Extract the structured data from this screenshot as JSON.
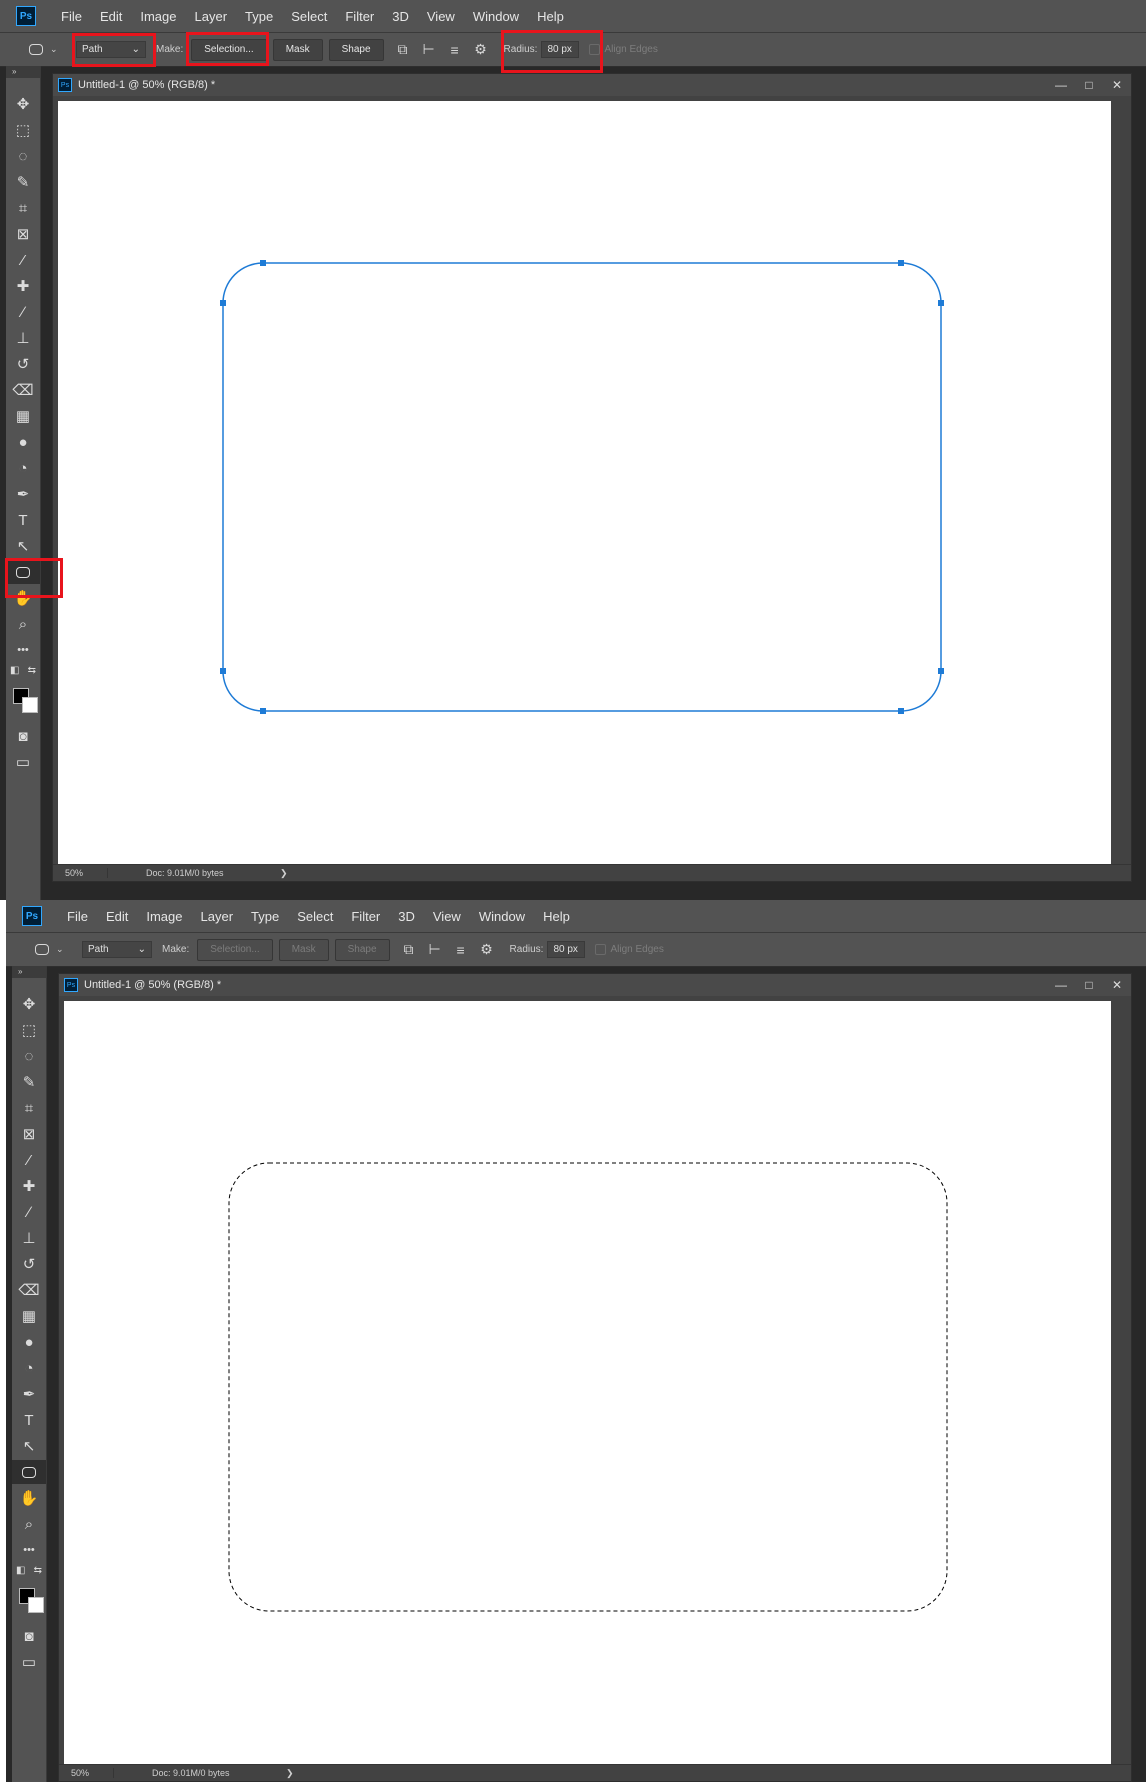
{
  "menus": [
    "File",
    "Edit",
    "Image",
    "Layer",
    "Type",
    "Select",
    "Filter",
    "3D",
    "View",
    "Window",
    "Help"
  ],
  "logo_text": "Ps",
  "options": {
    "mode_value": "Path",
    "make_label": "Make:",
    "selection_label": "Selection...",
    "mask_label": "Mask",
    "shape_label": "Shape",
    "radius_label": "Radius:",
    "radius_value": "80 px",
    "align_edges_label": "Align Edges"
  },
  "document": {
    "title": "Untitled-1 @ 50% (RGB/8) *",
    "zoom": "50%",
    "doc_info": "Doc: 9.01M/0 bytes"
  },
  "icons": {
    "move": "✥",
    "marquee": "⬚",
    "lasso": "◌",
    "quick-select": "✎",
    "crop": "⌗",
    "frame": "⊠",
    "eyedropper": "⁄",
    "healing": "✚",
    "brush": "∕",
    "stamp": "⊥",
    "history-brush": "↺",
    "eraser": "⌫",
    "gradient": "▦",
    "blur": "●",
    "dodge": "◔",
    "pen": "✒",
    "type": "T",
    "path-select": "↖",
    "hand": "✋",
    "zoom": "⌕",
    "more": "•••",
    "quick-mask": "◙",
    "screen-mode": "▭",
    "default-colors": "◧",
    "swap-colors": "⇆"
  },
  "colors": {
    "accent": "#31a8ff",
    "path": "#1e7bd6",
    "highlight": "#e8141c"
  },
  "annotations": {
    "top_highlights": [
      "mode-select",
      "selection-button",
      "radius-field",
      "rounded-rectangle-tool"
    ]
  }
}
